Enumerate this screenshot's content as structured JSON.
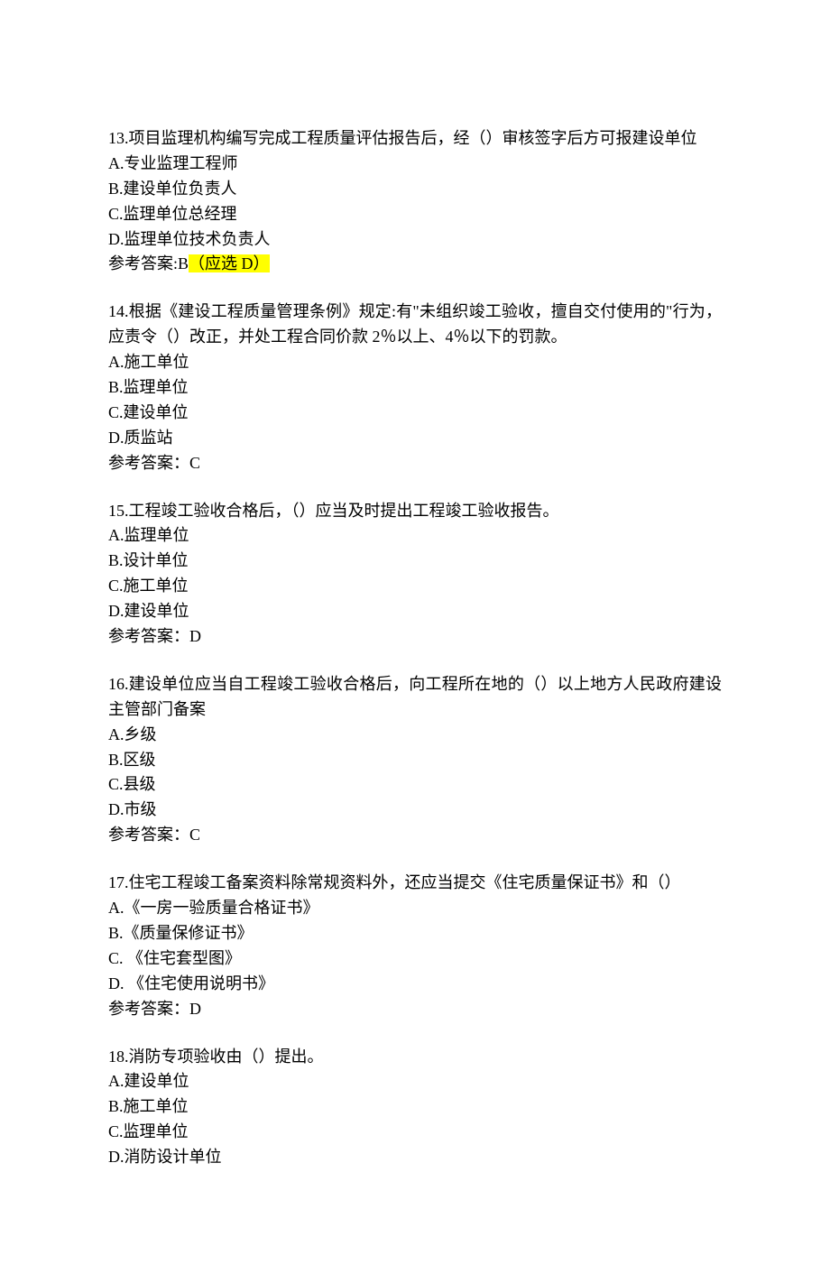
{
  "questions": [
    {
      "number": "13.",
      "text": "项目监理机构编写完成工程质量评估报告后，经（）审核签字后方可报建设单位",
      "options": [
        "A.专业监理工程师",
        "B.建设单位负责人",
        "C.监理单位总经理",
        "D.监理单位技术负责人"
      ],
      "answer_prefix": "参考答案:B",
      "answer_highlight": "（应选 D）"
    },
    {
      "number": "14.",
      "text": "根据《建设工程质量管理条例》规定:有\"未组织竣工验收，擅自交付使用的\"行为，应责令（）改正，并处工程合同价款 2％以上、4％以下的罚款。",
      "options": [
        "A.施工单位",
        "B.监理单位",
        "C.建设单位",
        "D.质监站"
      ],
      "answer_prefix": "参考答案：C",
      "answer_highlight": ""
    },
    {
      "number": "15.",
      "text": "工程竣工验收合格后，（）应当及时提出工程竣工验收报告。",
      "options": [
        "A.监理单位",
        "B.设计单位",
        "C.施工单位",
        "D.建设单位"
      ],
      "answer_prefix": "参考答案：D",
      "answer_highlight": ""
    },
    {
      "number": "16.",
      "text": "建设单位应当自工程竣工验收合格后，向工程所在地的（）以上地方人民政府建设主管部门备案",
      "options": [
        "A.乡级",
        "B.区级",
        "C.县级",
        "D.市级"
      ],
      "answer_prefix": "参考答案：C",
      "answer_highlight": ""
    },
    {
      "number": "17.",
      "text": "住宅工程竣工备案资料除常规资料外，还应当提交《住宅质量保证书》和（）",
      "options": [
        "A.《一房一验质量合格证书》",
        "B.《质量保修证书》",
        "C. 《住宅套型图》",
        "D. 《住宅使用说明书》"
      ],
      "answer_prefix": "参考答案：D",
      "answer_highlight": ""
    },
    {
      "number": "18.",
      "text": "消防专项验收由（）提出。",
      "options": [
        "A.建设单位",
        "B.施工单位",
        "C.监理单位",
        "D.消防设计单位"
      ],
      "answer_prefix": "",
      "answer_highlight": ""
    }
  ]
}
